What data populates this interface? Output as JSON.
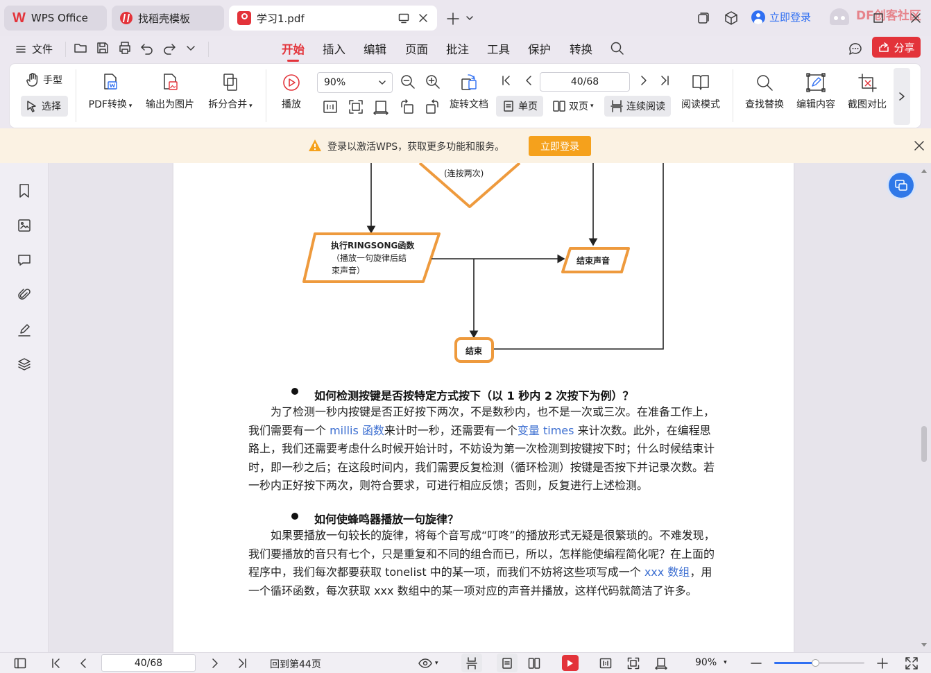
{
  "titlebar": {
    "tabs": [
      {
        "label": "WPS Office"
      },
      {
        "label": "找稻壳模板"
      },
      {
        "label": "学习1.pdf"
      }
    ],
    "login_label": "立即登录",
    "watermark_text": "DF创客社区"
  },
  "menubar": {
    "file_label": "文件",
    "items": [
      "开始",
      "插入",
      "编辑",
      "页面",
      "批注",
      "工具",
      "保护",
      "转换"
    ],
    "active_item": "开始",
    "share_label": "分享"
  },
  "ribbon": {
    "hand_label": "手型",
    "select_label": "选择",
    "pdf_convert_label": "PDF转换",
    "export_image_label": "输出为图片",
    "split_merge_label": "拆分合并",
    "play_label": "播放",
    "zoom_value": "90%",
    "page_value": "40/68",
    "rotate_label": "旋转文档",
    "single_page_label": "单页",
    "double_page_label": "双页",
    "continuous_label": "连续阅读",
    "read_mode_label": "阅读模式",
    "find_replace_label": "查找替换",
    "edit_content_label": "编辑内容",
    "screenshot_compare_label": "截图对比"
  },
  "notice": {
    "text": "登录以激活WPS，获取更多功能和服务。",
    "button_label": "立即登录"
  },
  "document": {
    "flowchart": {
      "top_node": "(连按两次)",
      "process_node_lines": [
        "执行RINGSONG函数",
        "（播放一句旋律后结",
        "束声音）"
      ],
      "end_sound_node": "结束声音",
      "end_node": "结束"
    },
    "section1": {
      "heading": "如何检测按键是否按特定方式按下（以 1 秒内 2 次按下为例）？",
      "p_a": "为了检测一秒内按键是否正好按下两次，不是数秒内，也不是一次或三次。在准备工作上，我们需要有一个 ",
      "p_link1": "millis 函数",
      "p_b": "来计时一秒，还需要有一个",
      "p_link2": "变量 times",
      "p_c": " 来计次数。此外，在编程思路上，我们还需要考虑什么时候开始计时，不妨设为第一次检测到按键按下时；什么时候结束计时，即一秒之后；在这段时间内，我们需要反复检测（循环检测）按键是否按下并记录次数。若一秒内正好按下两次，则符合要求，可进行相应反馈；否则，反复进行上述检测。"
    },
    "section2": {
      "heading": "如何使蜂鸣器播放一句旋律？",
      "p_a": "如果要播放一句较长的旋律，将每个音写成“叮咚”的播放形式无疑是很繁琐的。不难发现，我们要播放的音只有七个，只是重复和不同的组合而已，所以，怎样能使编程简化呢？在上面的程序中，我们每次都要获取 tonelist 中的某一项，而我们不妨将这些项写成一个 ",
      "p_link": "xxx 数组",
      "p_b": "，用一个循环函数，每次获取 xxx 数组中的某一项对应的声音并播放，这样代码就简洁了许多。"
    }
  },
  "statusbar": {
    "page_value": "40/68",
    "goto_label": "回到第44页",
    "zoom_value": "90%",
    "zoom_fraction": 0.45
  },
  "colors": {
    "accent_red": "#e3333a",
    "flow_orange": "#ee9a3d",
    "link_blue": "#3d6fd1",
    "notice_button": "#f5a11c"
  }
}
